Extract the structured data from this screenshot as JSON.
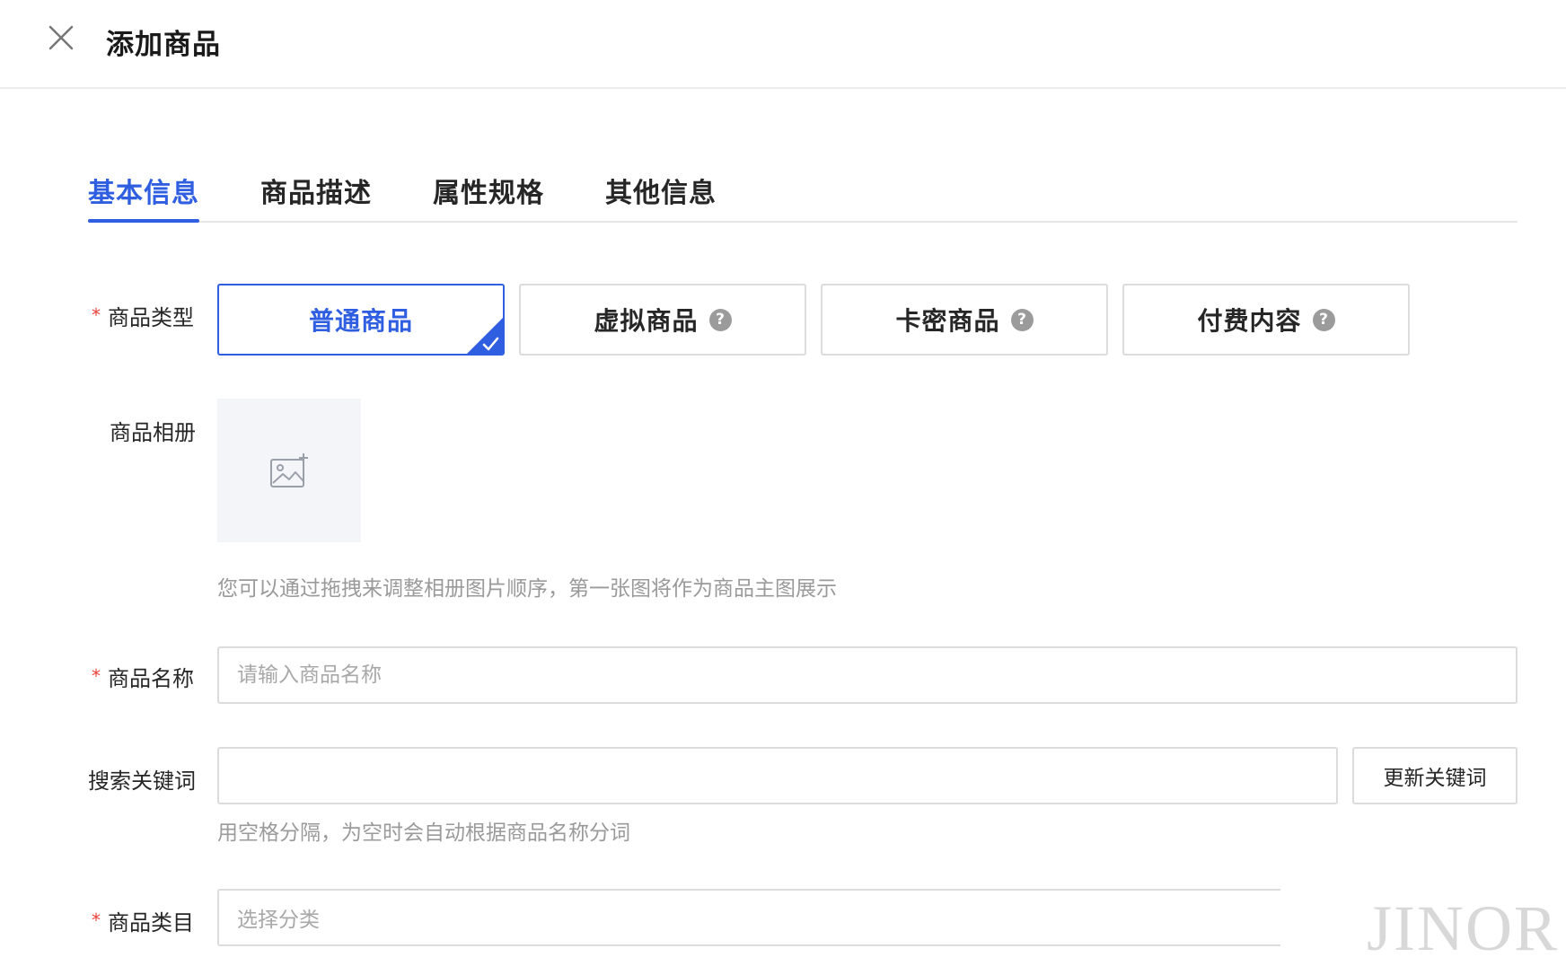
{
  "header": {
    "title": "添加商品"
  },
  "tabs": [
    {
      "label": "基本信息",
      "active": true
    },
    {
      "label": "商品描述",
      "active": false
    },
    {
      "label": "属性规格",
      "active": false
    },
    {
      "label": "其他信息",
      "active": false
    }
  ],
  "form": {
    "required_mark": "*",
    "product_type": {
      "label": "商品类型",
      "options": [
        {
          "label": "普通商品",
          "selected": true
        },
        {
          "label": "虚拟商品",
          "help": "?"
        },
        {
          "label": "卡密商品",
          "help": "?"
        },
        {
          "label": "付费内容",
          "help": "?"
        }
      ]
    },
    "album": {
      "label": "商品相册",
      "hint": "您可以通过拖拽来调整相册图片顺序，第一张图将作为商品主图展示"
    },
    "name": {
      "label": "商品名称",
      "placeholder": "请输入商品名称",
      "value": ""
    },
    "keywords": {
      "label": "搜索关键词",
      "value": "",
      "button": "更新关键词",
      "hint": "用空格分隔，为空时会自动根据商品名称分词"
    },
    "category": {
      "label": "商品类目",
      "placeholder": "选择分类"
    }
  },
  "watermark": "JINOR",
  "colors": {
    "accent": "#2f5fe0",
    "required": "#e8403a",
    "hint": "#9a9a9a",
    "border": "#dcdcdc"
  }
}
